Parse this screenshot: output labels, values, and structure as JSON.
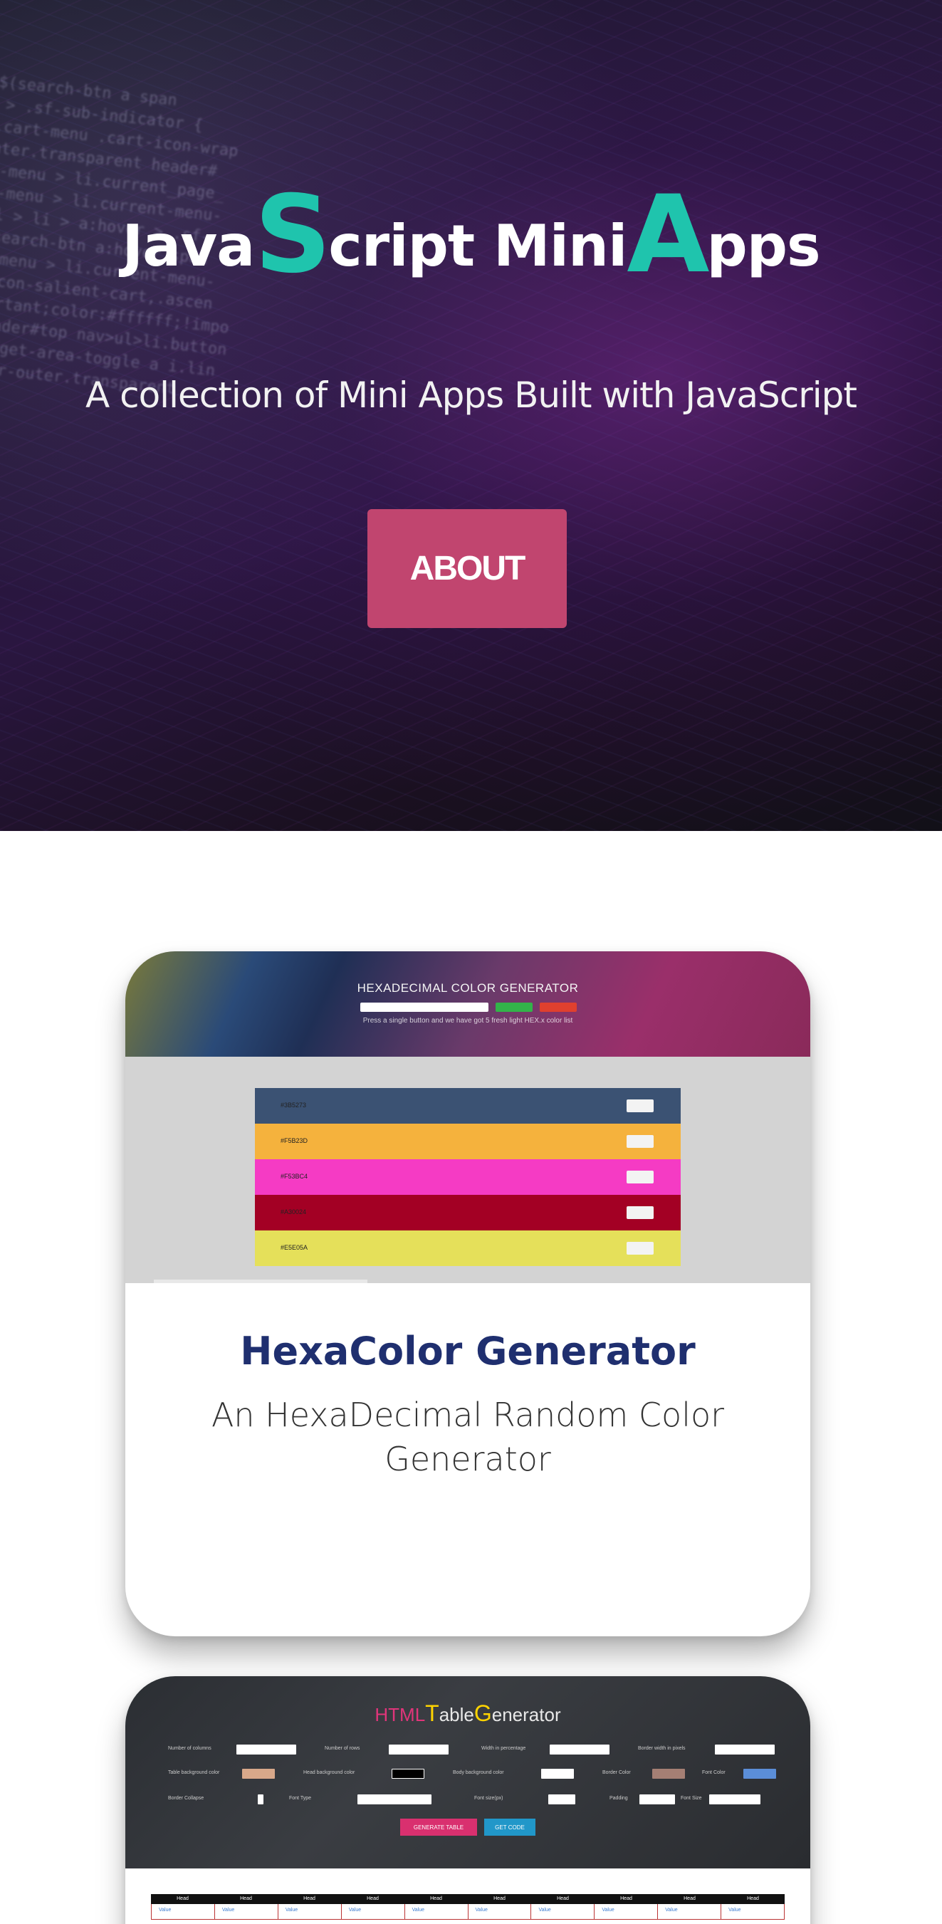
{
  "hero": {
    "title_part1": "Java",
    "title_big_s": "S",
    "title_part2": "cript Mini",
    "title_big_a": "A",
    "title_part3": "pps",
    "subtitle": "A collection of Mini Apps Built with JavaScript",
    "about_label": "ABOUT",
    "code_background": "$(search-btn a span\n > .sf-sub-indicator {\n.cart-menu .cart-icon-wrap\nuter.transparent header#\nf-menu > li.current_page_\nf-menu > li.current-menu-\nul > li > a:hover > .sf-\n#search-btn a:hover span\nf-menu > li.current-menu-\n.icon-salient-cart,.ascen\nportant;color:#ffffff;!impo\nheader#top nav>ul>li.button\nwidget-area-toggle a i.lin\nader-outer.transparent"
  },
  "colors": {
    "accent": "#1fc4ad",
    "about_button": "#c1456f",
    "card_title": "#1f2f6f"
  },
  "cards": [
    {
      "title": "HexaColor Generator",
      "description": "An HexaDecimal Random Color Generator",
      "preview": {
        "heading": "HEXADECIMAL COLOR GENERATOR",
        "note": "Press a single button and we have got 5 fresh light HEX.x color list",
        "rows": [
          {
            "hex": "#3B5273",
            "color": "#3b5273"
          },
          {
            "hex": "#F5B23D",
            "color": "#f5b23d"
          },
          {
            "hex": "#F53BC4",
            "color": "#f53bc4"
          },
          {
            "hex": "#A30024",
            "color": "#a30024"
          },
          {
            "hex": "#E5E05A",
            "color": "#e5e05a"
          }
        ]
      }
    },
    {
      "preview": {
        "title_html": "HTML",
        "title_t": "T",
        "title_able": "able",
        "title_g": "G",
        "title_enerator": "enerator",
        "generate_label": "GENERATE TABLE",
        "download_label": "GET CODE",
        "row1": [
          "Number of columns",
          "Number of rows",
          "Width in percentage",
          "Border width in pixels"
        ],
        "row2": [
          "Table background color",
          "Head background color",
          "Body background color",
          "Border Color",
          "Font Color"
        ],
        "row3": [
          "Border Collapse",
          "Font Type",
          "Font size(px)",
          "Padding",
          "Font Size"
        ],
        "table_head": [
          "Head",
          "Head",
          "Head",
          "Head",
          "Head",
          "Head",
          "Head",
          "Head",
          "Head",
          "Head"
        ],
        "table_cell": "Value"
      }
    }
  ]
}
